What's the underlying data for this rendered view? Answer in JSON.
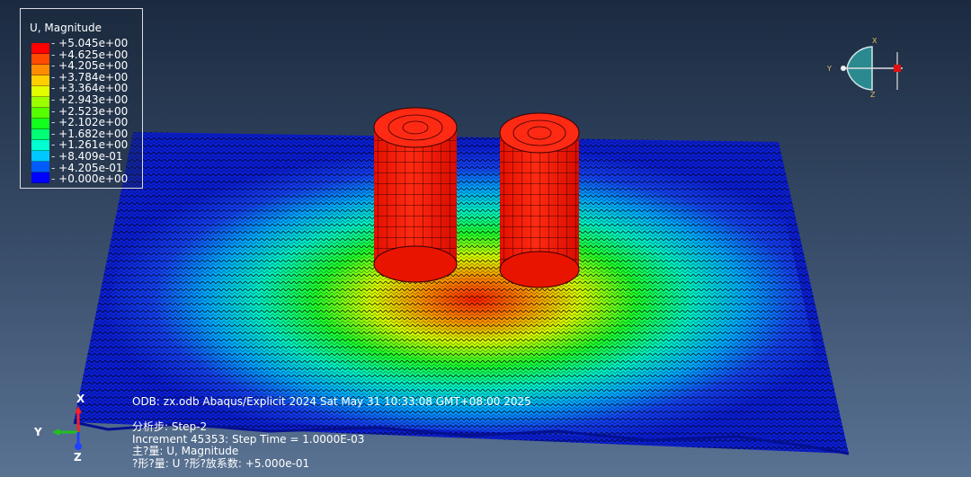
{
  "legend": {
    "title": "U, Magnitude",
    "levels": [
      {
        "label": "+5.045e+00",
        "color": "#ff0000"
      },
      {
        "label": "+4.625e+00",
        "color": "#ff4b00"
      },
      {
        "label": "+4.205e+00",
        "color": "#ff8c00"
      },
      {
        "label": "+3.784e+00",
        "color": "#ffcf00"
      },
      {
        "label": "+3.364e+00",
        "color": "#e1ff00"
      },
      {
        "label": "+2.943e+00",
        "color": "#9bff00"
      },
      {
        "label": "+2.523e+00",
        "color": "#56ff00"
      },
      {
        "label": "+2.102e+00",
        "color": "#12ff1e"
      },
      {
        "label": "+1.682e+00",
        "color": "#00ff74"
      },
      {
        "label": "+1.261e+00",
        "color": "#00ffd1"
      },
      {
        "label": "+8.409e-01",
        "color": "#00c8ff"
      },
      {
        "label": "+4.205e-01",
        "color": "#005cff"
      },
      {
        "label": "+0.000e+00",
        "color": "#0000ff"
      }
    ]
  },
  "info": {
    "odb_line": "ODB: zx.odb    Abaqus/Explicit 2024    Sat May 31 10:33:08 GMT+08:00 2025",
    "step": "分析步: Step-2",
    "increment": "Increment      45353: Step Time =    1.0000E-03",
    "primary": "主?量: U, Magnitude",
    "deformed": "?形?量: U   ?形?放系数: +5.000e-01"
  },
  "triad": {
    "x": "X",
    "y": "Y",
    "z": "Z"
  },
  "view_cube": {
    "x": "X",
    "y": "Y",
    "z": "Z"
  },
  "colors": {
    "background_top": "#1b2a40",
    "background_bottom": "#5a7393",
    "cylinder": "#ff1a0a",
    "mesh_low": "#0a1fd8"
  }
}
